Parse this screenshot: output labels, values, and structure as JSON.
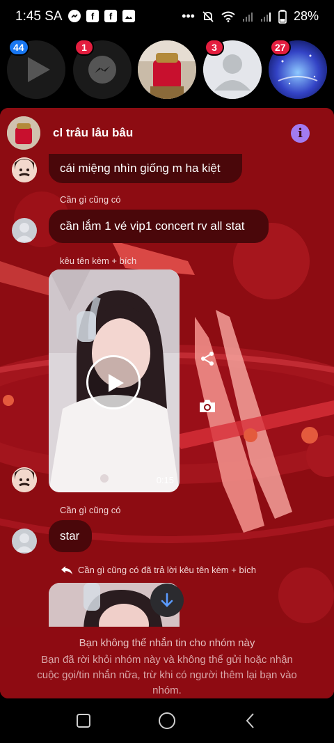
{
  "status_bar": {
    "time": "1:45 SA",
    "battery": "28%",
    "left_icons": [
      "messenger-icon",
      "facebook-icon",
      "facebook-icon",
      "gallery-icon"
    ],
    "right_icons": [
      "more-dots-icon",
      "mute-icon",
      "wifi-icon",
      "signal-icon",
      "signal-icon",
      "battery-icon"
    ]
  },
  "chat_heads": [
    {
      "badge": "44",
      "icon": "play-icon"
    },
    {
      "badge": "1",
      "icon": "messenger-icon"
    },
    {
      "badge": "",
      "icon": "group-photo"
    },
    {
      "badge": "3",
      "icon": "default-avatar"
    },
    {
      "badge": "27",
      "icon": "galaxy-photo"
    }
  ],
  "chat": {
    "title": "cl trâu lâu bâu",
    "messages": [
      {
        "sender": "",
        "text": "cái miệng nhìn giống m ha kiệt"
      },
      {
        "sender": "Cần gì cũng có",
        "text": "cần lắm 1 vé vip1 concert rv all stat"
      },
      {
        "sender": "kêu tên kèm + bích",
        "video_duration": "0:15"
      },
      {
        "sender": "Cần gì cũng có",
        "text": "star"
      }
    ],
    "reply_line": "Cần gì cũng có đã trả lời kêu tên kèm + bích"
  },
  "notice": {
    "title": "Bạn không thể nhắn tin cho nhóm này",
    "body": "Bạn đã rời khỏi nhóm này và không thể gửi hoặc nhận cuộc gọi/tin nhắn nữa, trừ khi có người thêm lại bạn vào nhóm."
  },
  "nav_bar": {
    "buttons": [
      "recents-icon",
      "home-icon",
      "back-icon"
    ]
  },
  "colors": {
    "panel_bg": "#8d0c12",
    "bubble_bg": "#4a070a",
    "badge_red": "#e41e3f",
    "badge_blue": "#1877f2",
    "info_purple": "#a27bf0"
  }
}
